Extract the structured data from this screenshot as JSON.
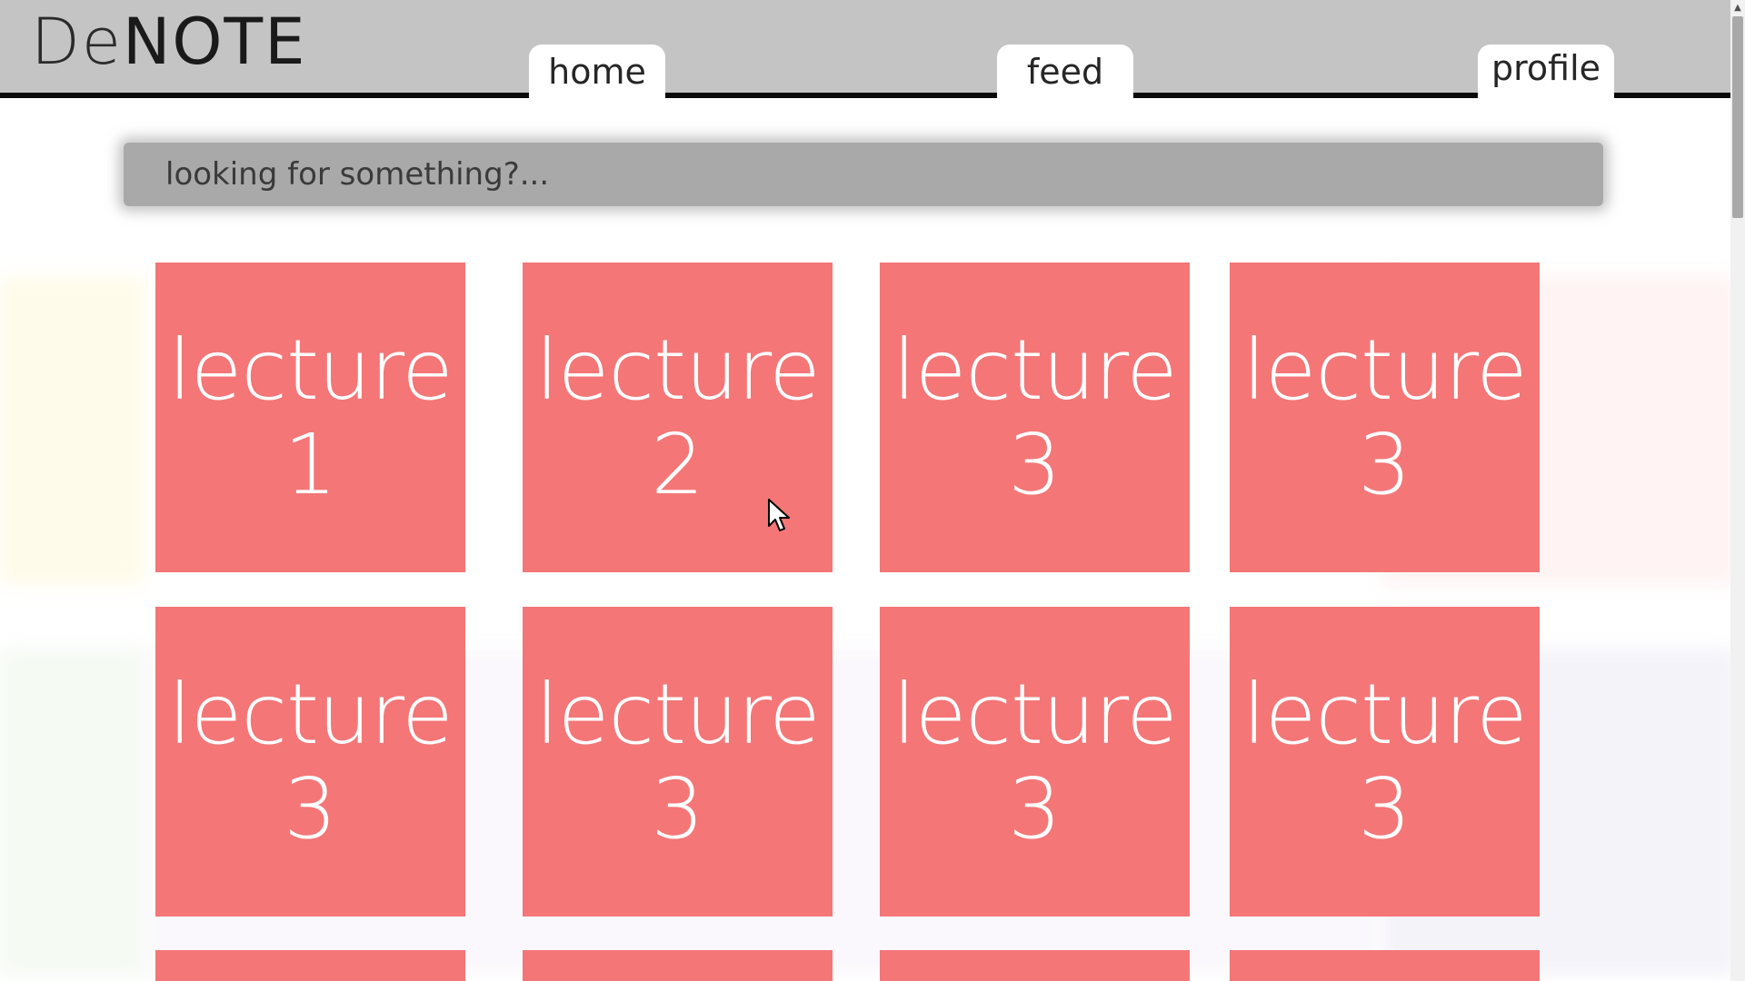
{
  "app": {
    "logo_part1": "De",
    "logo_part2": "NOTE"
  },
  "nav": {
    "home": "home",
    "feed": "feed",
    "profile": "profile"
  },
  "search": {
    "placeholder": "looking for something?..."
  },
  "tiles": [
    {
      "word": "lecture",
      "number": "1"
    },
    {
      "word": "lecture",
      "number": "2"
    },
    {
      "word": "lecture",
      "number": "3"
    },
    {
      "word": "lecture",
      "number": "3"
    },
    {
      "word": "lecture",
      "number": "3"
    },
    {
      "word": "lecture",
      "number": "3"
    },
    {
      "word": "lecture",
      "number": "3"
    },
    {
      "word": "lecture",
      "number": "3"
    },
    {
      "word": "",
      "number": ""
    },
    {
      "word": "",
      "number": ""
    },
    {
      "word": "",
      "number": ""
    },
    {
      "word": "",
      "number": ""
    }
  ],
  "colors": {
    "tile": "#f47677",
    "header": "#c4c4c4",
    "search": "#a9a9a9",
    "header_border": "#0a0a0a"
  },
  "icons": {
    "cursor": "mouse-pointer-icon",
    "scroll_up": "scroll-up-arrow-icon"
  }
}
